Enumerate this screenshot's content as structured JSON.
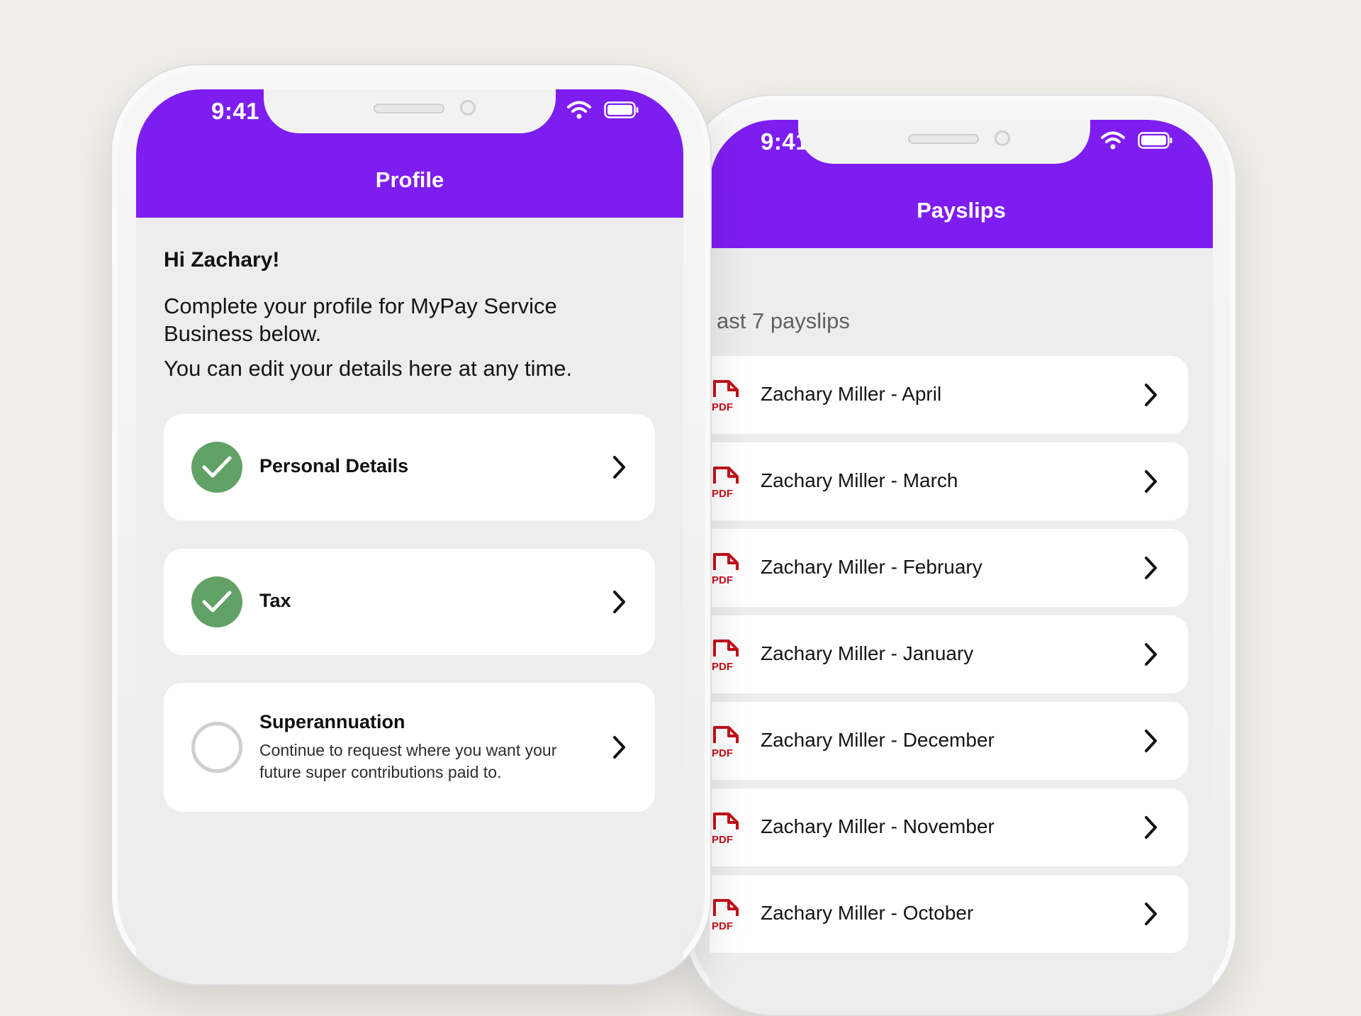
{
  "colors": {
    "brand": "#7e1df0",
    "check": "#62a165",
    "pdf": "#c2111a",
    "background": "#f0eee9"
  },
  "profile_phone": {
    "status_time": "9:41",
    "title": "Profile",
    "greeting": "Hi Zachary!",
    "intro": "Complete your profile for MyPay Service Business below.",
    "edit_note": "You can edit your details here at any time.",
    "items": [
      {
        "label": "Personal Details",
        "complete": true,
        "icon": "check-circle-icon"
      },
      {
        "label": "Tax",
        "complete": true,
        "icon": "check-circle-icon"
      },
      {
        "label": "Superannuation",
        "complete": false,
        "icon": "empty-circle-icon",
        "description": "Continue to request where you want your future super contributions paid to."
      }
    ]
  },
  "payslips_phone": {
    "status_time": "9:41",
    "title": "Payslips",
    "subtitle": "ast 7 payslips",
    "file_icon_label": "PDF",
    "payslips": [
      {
        "label": "Zachary Miller - April"
      },
      {
        "label": "Zachary Miller - March"
      },
      {
        "label": "Zachary Miller - February"
      },
      {
        "label": "Zachary Miller - January"
      },
      {
        "label": "Zachary Miller - December"
      },
      {
        "label": "Zachary Miller - November"
      },
      {
        "label": "Zachary Miller - October"
      }
    ]
  }
}
